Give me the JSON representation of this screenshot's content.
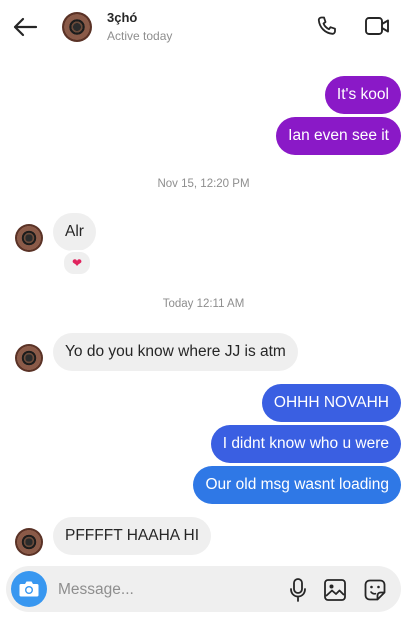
{
  "header": {
    "contact_name": "3çhó",
    "status": "Active today"
  },
  "messages": [
    {
      "text": "It's kool",
      "sender": "me"
    },
    {
      "text": "Ian even see it",
      "sender": "me"
    },
    {
      "text": "Alr",
      "sender": "them",
      "reaction": "❤"
    },
    {
      "text": "Yo do you know where JJ is atm",
      "sender": "them"
    },
    {
      "text": "OHHH NOVAHH",
      "sender": "me"
    },
    {
      "text": "I didnt know who u were",
      "sender": "me"
    },
    {
      "text": "Our old msg wasnt loading",
      "sender": "me"
    },
    {
      "text": "PFFFFT HAAHA HI",
      "sender": "them"
    }
  ],
  "timestamps": [
    "Nov 15, 12:20 PM",
    "Today 12:11 AM"
  ],
  "composer": {
    "placeholder": "Message..."
  },
  "colors": {
    "purple_bubble": "#8a19c7",
    "blue_bubble": "#3a5fe2",
    "incoming_bubble": "#efefef",
    "camera_button": "#3897f0"
  }
}
